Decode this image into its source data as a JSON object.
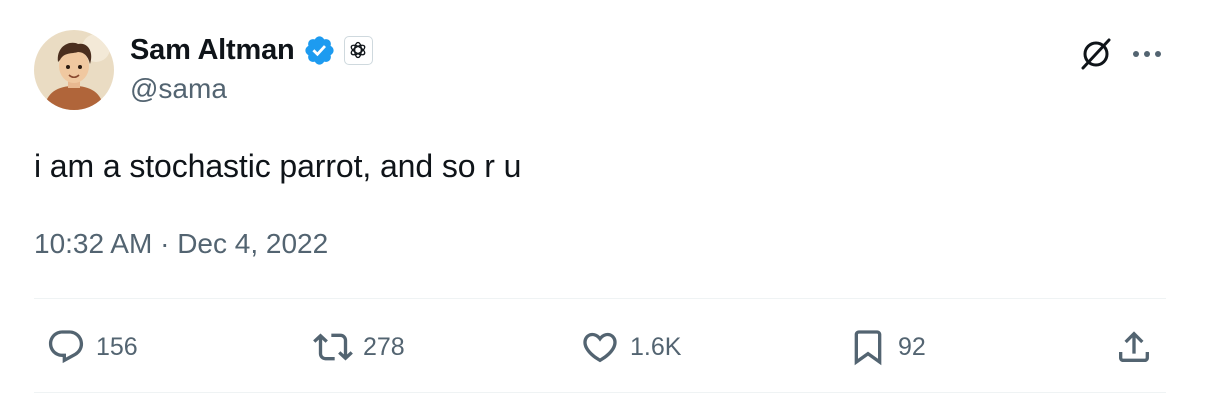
{
  "author": {
    "display_name": "Sam Altman",
    "handle": "@sama",
    "verified_color": "#1d9bf0"
  },
  "tweet": {
    "text": "i am a stochastic parrot, and so r u",
    "time": "10:32 AM",
    "separator": "·",
    "date": "Dec 4, 2022"
  },
  "header_icons": [
    "grok-icon",
    "more-icon"
  ],
  "actions": {
    "replies": "156",
    "retweets": "278",
    "likes": "1.6K",
    "bookmarks": "92"
  },
  "colors": {
    "text_primary": "#0f1419",
    "text_secondary": "#536471",
    "divider": "#eff3f4"
  }
}
